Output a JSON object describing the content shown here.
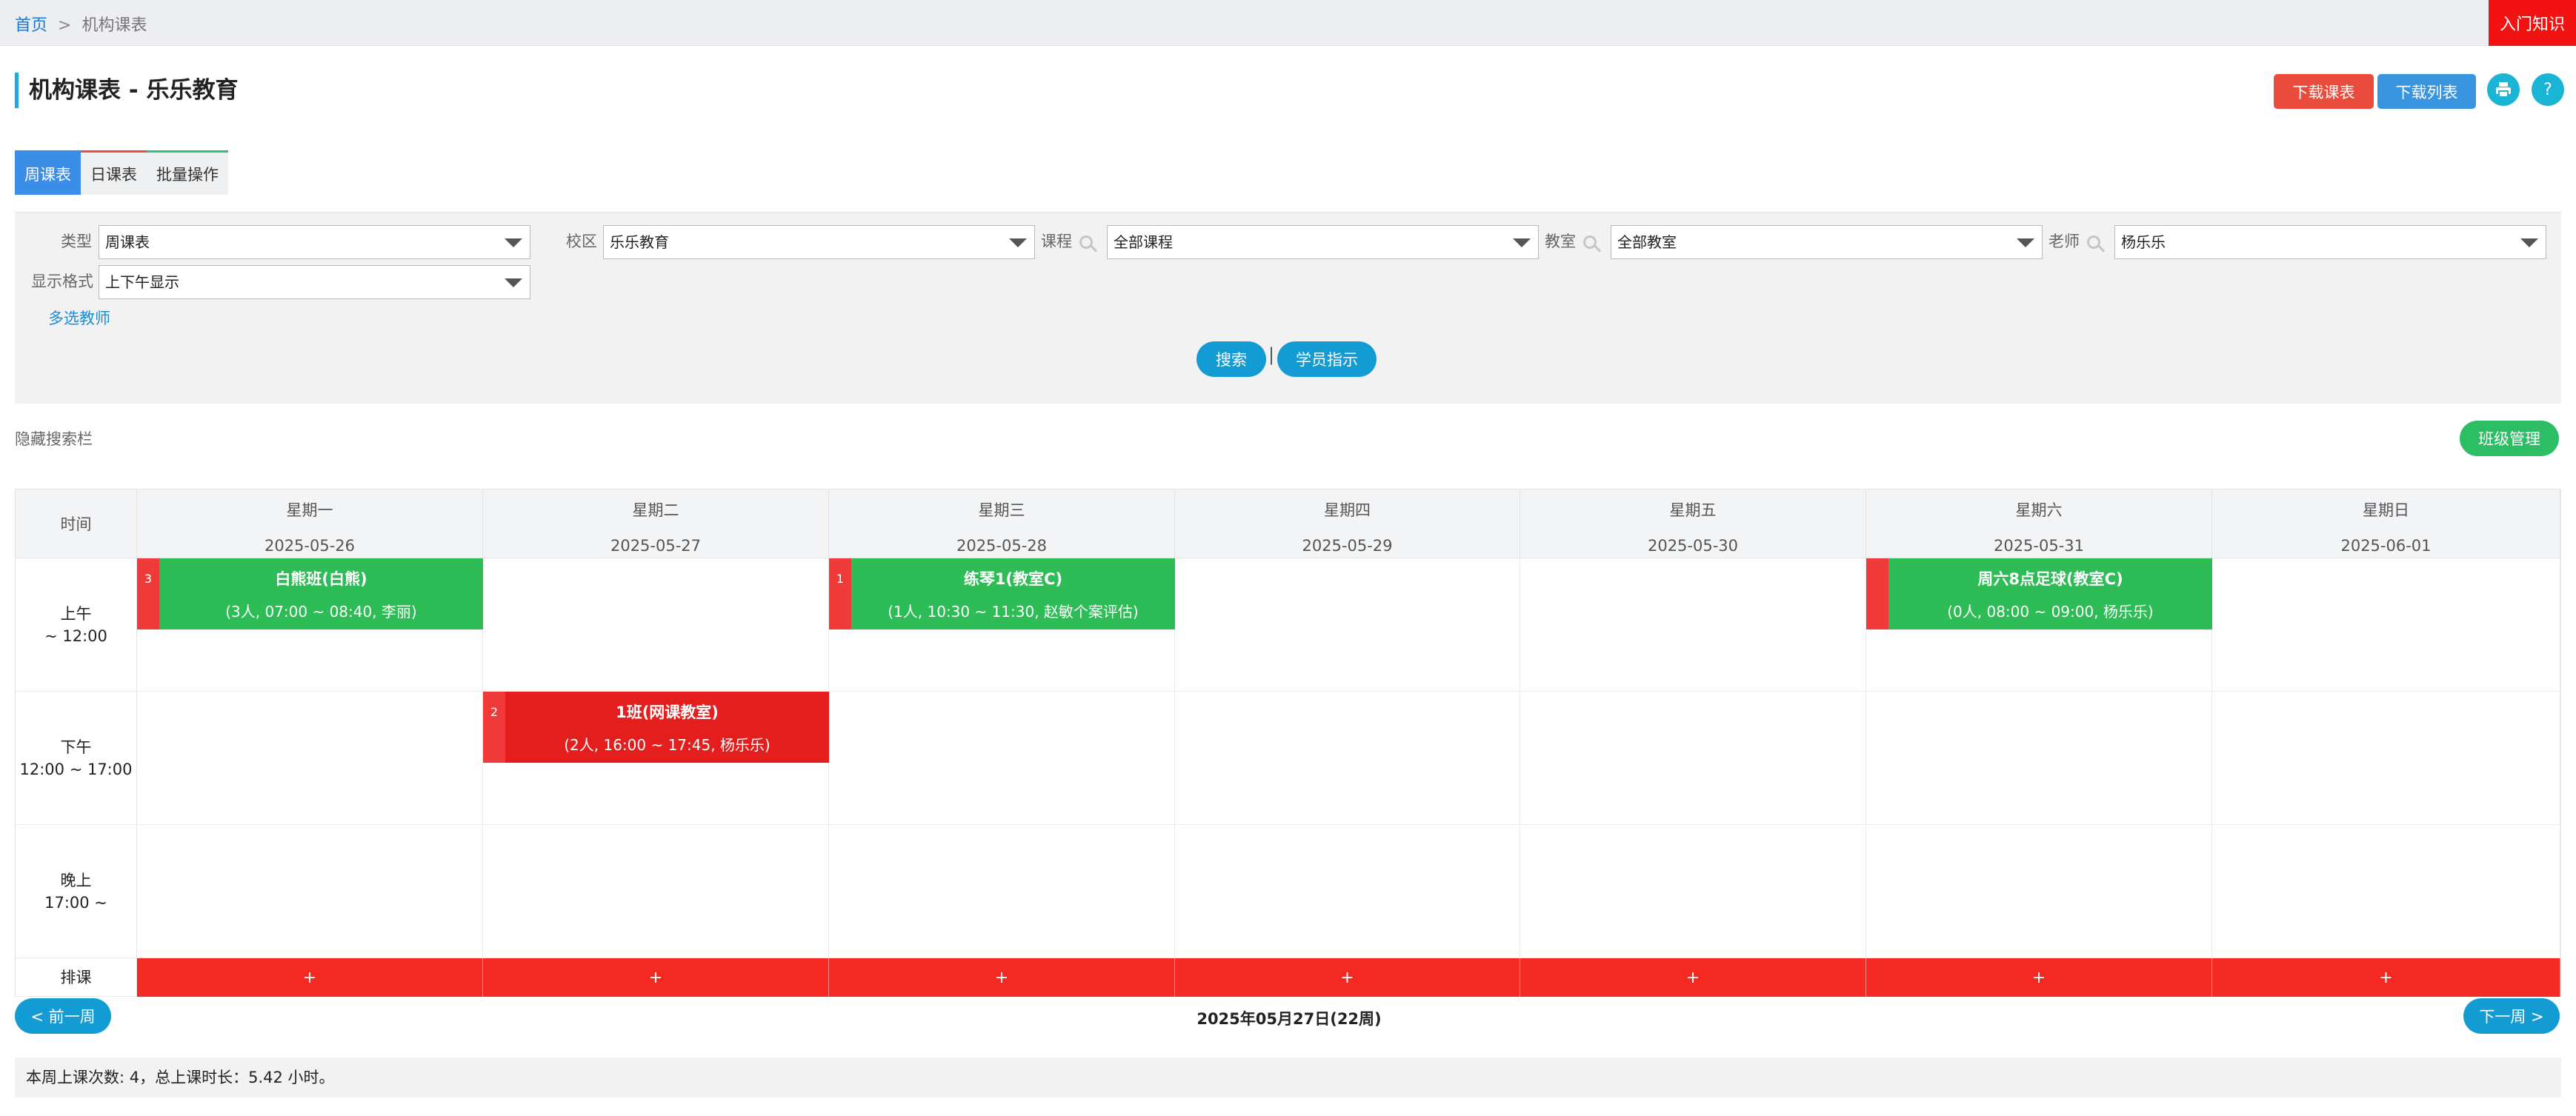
{
  "breadcrumb": {
    "home": "首页",
    "sep": ">",
    "current": "机构课表"
  },
  "intro_button": "入门知识",
  "page_title": "机构课表 - 乐乐教育",
  "header_buttons": {
    "download_schedule": "下载课表",
    "download_list": "下载列表",
    "print_icon": "print-icon",
    "help": "?"
  },
  "tabs": [
    {
      "label": "周课表",
      "active": true
    },
    {
      "label": "日课表",
      "active": false
    },
    {
      "label": "批量操作",
      "active": false
    }
  ],
  "filters": {
    "type": {
      "label": "类型",
      "value": "周课表"
    },
    "campus": {
      "label": "校区",
      "value": "乐乐教育"
    },
    "course": {
      "label": "课程",
      "value": "全部课程"
    },
    "classroom": {
      "label": "教室",
      "value": "全部教室"
    },
    "teacher": {
      "label": "老师",
      "value": "杨乐乐"
    },
    "display": {
      "label": "显示格式",
      "value": "上下午显示"
    },
    "multi_teacher": "多选教师",
    "search_button": "搜索",
    "pipe": "|",
    "student_button": "学员指示"
  },
  "hide_search": "隐藏搜索栏",
  "class_manage": "班级管理",
  "schedule": {
    "time_header": "时间",
    "days": [
      {
        "name": "星期一",
        "date": "2025-05-26"
      },
      {
        "name": "星期二",
        "date": "2025-05-27"
      },
      {
        "name": "星期三",
        "date": "2025-05-28"
      },
      {
        "name": "星期四",
        "date": "2025-05-29"
      },
      {
        "name": "星期五",
        "date": "2025-05-30"
      },
      {
        "name": "星期六",
        "date": "2025-05-31"
      },
      {
        "name": "星期日",
        "date": "2025-06-01"
      }
    ],
    "periods": [
      {
        "name": "上午",
        "range": "~ 12:00"
      },
      {
        "name": "下午",
        "range": "12:00 ~ 17:00"
      },
      {
        "name": "晚上",
        "range": "17:00 ~"
      }
    ],
    "arrange_label": "排课",
    "plus": "+",
    "events": [
      {
        "day": 0,
        "period": 0,
        "badge": "3",
        "title": "白熊班(白熊)",
        "detail": "(3人, 07:00 ~ 08:40, 李丽)",
        "color": "#2dbc55"
      },
      {
        "day": 2,
        "period": 0,
        "badge": "1",
        "title": "练琴1(教室C)",
        "detail": "(1人, 10:30 ~ 11:30, 赵敏个案评估)",
        "color": "#2dbc55"
      },
      {
        "day": 5,
        "period": 0,
        "badge": "",
        "title": "周六8点足球(教室C)",
        "detail": "(0人, 08:00 ~ 09:00, 杨乐乐)",
        "color": "#2dbc55"
      },
      {
        "day": 1,
        "period": 1,
        "badge": "2",
        "title": "1班(网课教室)",
        "detail": "(2人, 16:00 ~ 17:45, 杨乐乐)",
        "color": "#e41d1d"
      }
    ]
  },
  "week_nav": {
    "prev": "< 前一周",
    "current": "2025年05月27日(22周)",
    "next": "下一周 >"
  },
  "summary": "本周上课次数: 4，总上课时长：5.42 小时。"
}
